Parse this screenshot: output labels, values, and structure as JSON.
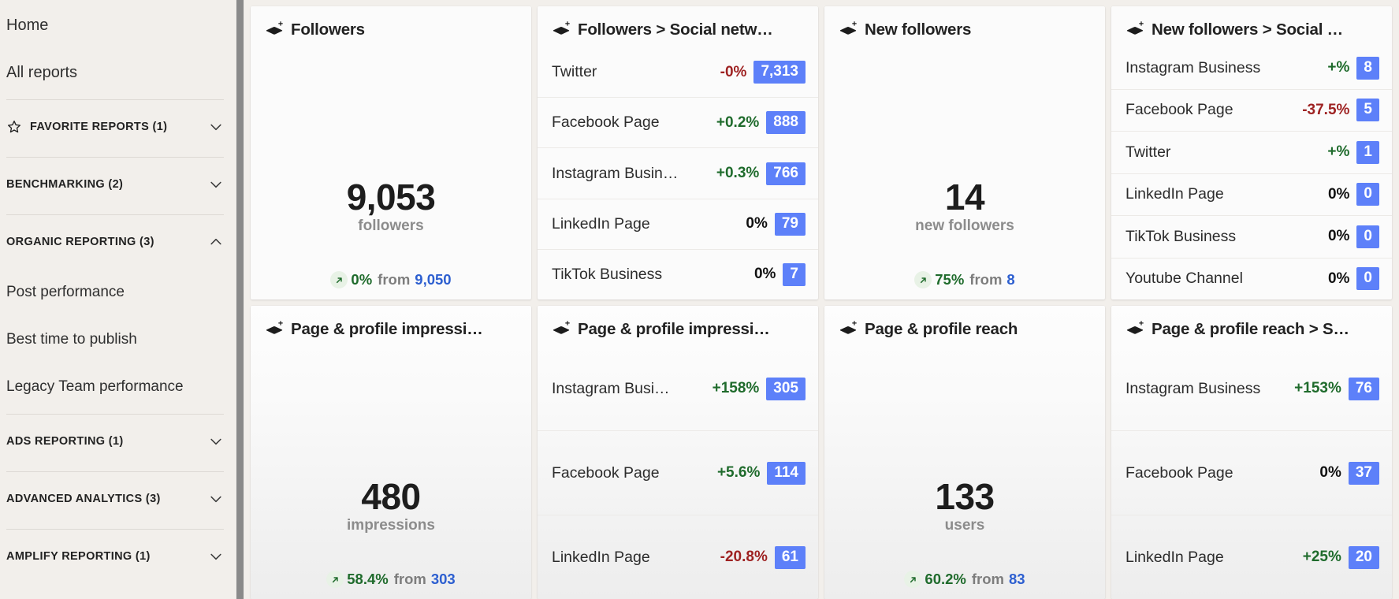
{
  "sidebar": {
    "links": [
      {
        "label": "Home"
      },
      {
        "label": "All reports"
      }
    ],
    "groups": [
      {
        "label": "FAVORITE REPORTS (1)",
        "icon": "star-icon",
        "expanded": false,
        "items": []
      },
      {
        "label": "BENCHMARKING (2)",
        "icon": null,
        "expanded": false,
        "items": []
      },
      {
        "label": "ORGANIC REPORTING (3)",
        "icon": null,
        "expanded": true,
        "items": [
          {
            "label": "Post performance"
          },
          {
            "label": "Best time to publish"
          },
          {
            "label": "Legacy Team performance"
          }
        ]
      },
      {
        "label": "ADS REPORTING (1)",
        "icon": null,
        "expanded": false,
        "items": []
      },
      {
        "label": "ADVANCED ANALYTICS (3)",
        "icon": null,
        "expanded": false,
        "items": []
      },
      {
        "label": "AMPLIFY REPORTING (1)",
        "icon": null,
        "expanded": false,
        "items": []
      }
    ]
  },
  "colors": {
    "badge_blue": "#5d80f9",
    "positive_green": "#1f6b2c",
    "negative_red": "#9e2222",
    "link_blue": "#2d5fd0",
    "page_bg": "#f2efeb"
  },
  "cards": [
    {
      "id": "followers",
      "type": "metric",
      "icon": "layers-plus-icon",
      "title": "Followers",
      "value": "9,053",
      "unit": "followers",
      "delta": "0%",
      "delta_dir": "up",
      "delta_sign": "positive",
      "from_label": "from",
      "previous": "9,050",
      "gradient": false
    },
    {
      "id": "followers-by-network",
      "type": "breakdown",
      "icon": "layers-plus-icon",
      "title": "Followers > Social netw…",
      "gradient": false,
      "rows": [
        {
          "name": "Twitter",
          "pct": "-0%",
          "sign": "negative",
          "value": "7,313"
        },
        {
          "name": "Facebook Page",
          "pct": "+0.2%",
          "sign": "positive",
          "value": "888"
        },
        {
          "name": "Instagram Busin…",
          "pct": "+0.3%",
          "sign": "positive",
          "value": "766"
        },
        {
          "name": "LinkedIn Page",
          "pct": "0%",
          "sign": "zero",
          "value": "79"
        },
        {
          "name": "TikTok Business",
          "pct": "0%",
          "sign": "zero",
          "value": "7"
        }
      ]
    },
    {
      "id": "new-followers",
      "type": "metric",
      "icon": "layers-plus-icon",
      "title": "New followers",
      "value": "14",
      "unit": "new followers",
      "delta": "75%",
      "delta_dir": "up",
      "delta_sign": "positive",
      "from_label": "from",
      "previous": "8",
      "gradient": false
    },
    {
      "id": "new-followers-by-network",
      "type": "breakdown",
      "icon": "layers-plus-icon",
      "title": "New followers > Social …",
      "gradient": false,
      "rows": [
        {
          "name": "Instagram Business",
          "pct": "+%",
          "sign": "positive",
          "value": "8"
        },
        {
          "name": "Facebook Page",
          "pct": "-37.5%",
          "sign": "negative",
          "value": "5"
        },
        {
          "name": "Twitter",
          "pct": "+%",
          "sign": "positive",
          "value": "1"
        },
        {
          "name": "LinkedIn Page",
          "pct": "0%",
          "sign": "zero",
          "value": "0"
        },
        {
          "name": "TikTok Business",
          "pct": "0%",
          "sign": "zero",
          "value": "0"
        },
        {
          "name": "Youtube Channel",
          "pct": "0%",
          "sign": "zero",
          "value": "0"
        }
      ]
    },
    {
      "id": "impressions",
      "type": "metric",
      "icon": "layers-plus-icon",
      "title": "Page & profile impressi…",
      "value": "480",
      "unit": "impressions",
      "delta": "58.4%",
      "delta_dir": "up",
      "delta_sign": "positive",
      "from_label": "from",
      "previous": "303",
      "gradient": true
    },
    {
      "id": "impressions-by-network",
      "type": "breakdown",
      "icon": "layers-plus-icon",
      "title": "Page & profile impressi…",
      "gradient": true,
      "rows": [
        {
          "name": "Instagram Busi…",
          "pct": "+158%",
          "sign": "positive",
          "value": "305"
        },
        {
          "name": "Facebook Page",
          "pct": "+5.6%",
          "sign": "positive",
          "value": "114"
        },
        {
          "name": "LinkedIn Page",
          "pct": "-20.8%",
          "sign": "negative",
          "value": "61"
        }
      ]
    },
    {
      "id": "reach",
      "type": "metric",
      "icon": "layers-plus-icon",
      "title": "Page & profile reach",
      "value": "133",
      "unit": "users",
      "delta": "60.2%",
      "delta_dir": "up",
      "delta_sign": "positive",
      "from_label": "from",
      "previous": "83",
      "gradient": true
    },
    {
      "id": "reach-by-network",
      "type": "breakdown",
      "icon": "layers-plus-icon",
      "title": "Page & profile reach > S…",
      "gradient": true,
      "rows": [
        {
          "name": "Instagram Business",
          "pct": "+153%",
          "sign": "positive",
          "value": "76"
        },
        {
          "name": "Facebook Page",
          "pct": "0%",
          "sign": "zero",
          "value": "37"
        },
        {
          "name": "LinkedIn Page",
          "pct": "+25%",
          "sign": "positive",
          "value": "20"
        }
      ]
    }
  ]
}
